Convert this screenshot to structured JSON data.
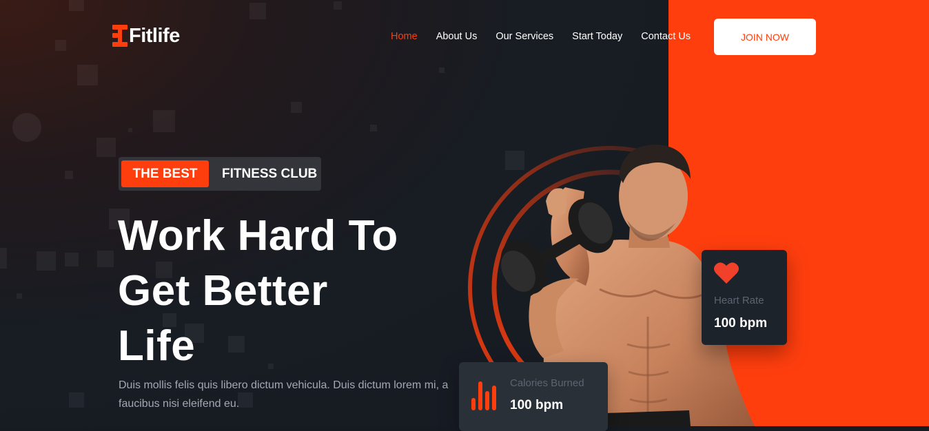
{
  "brand": {
    "name": "Fitlife",
    "accent": "#ff3e0e",
    "dark_bg": "#161b22"
  },
  "nav": {
    "items": [
      {
        "label": "Home",
        "active": true
      },
      {
        "label": "About Us",
        "active": false
      },
      {
        "label": "Our Services",
        "active": false
      },
      {
        "label": "Start Today",
        "active": false
      },
      {
        "label": "Contact Us",
        "active": false
      }
    ],
    "join_label": "JOIN NOW"
  },
  "hero": {
    "badge_strong": "THE BEST",
    "badge_light": "FITNESS CLUB",
    "headline_lines": [
      "Work Hard To",
      "Get Better",
      "Life"
    ],
    "description": "Duis mollis felis quis libero dictum vehicula. Duis dictum lorem mi, a faucibus nisi eleifend eu."
  },
  "stats": {
    "heart": {
      "icon": "heart-icon",
      "label": "Heart Rate",
      "value": "100 bpm"
    },
    "calories": {
      "icon": "bar-chart-icon",
      "label": "Calories Burned",
      "value": "100 bpm"
    }
  }
}
